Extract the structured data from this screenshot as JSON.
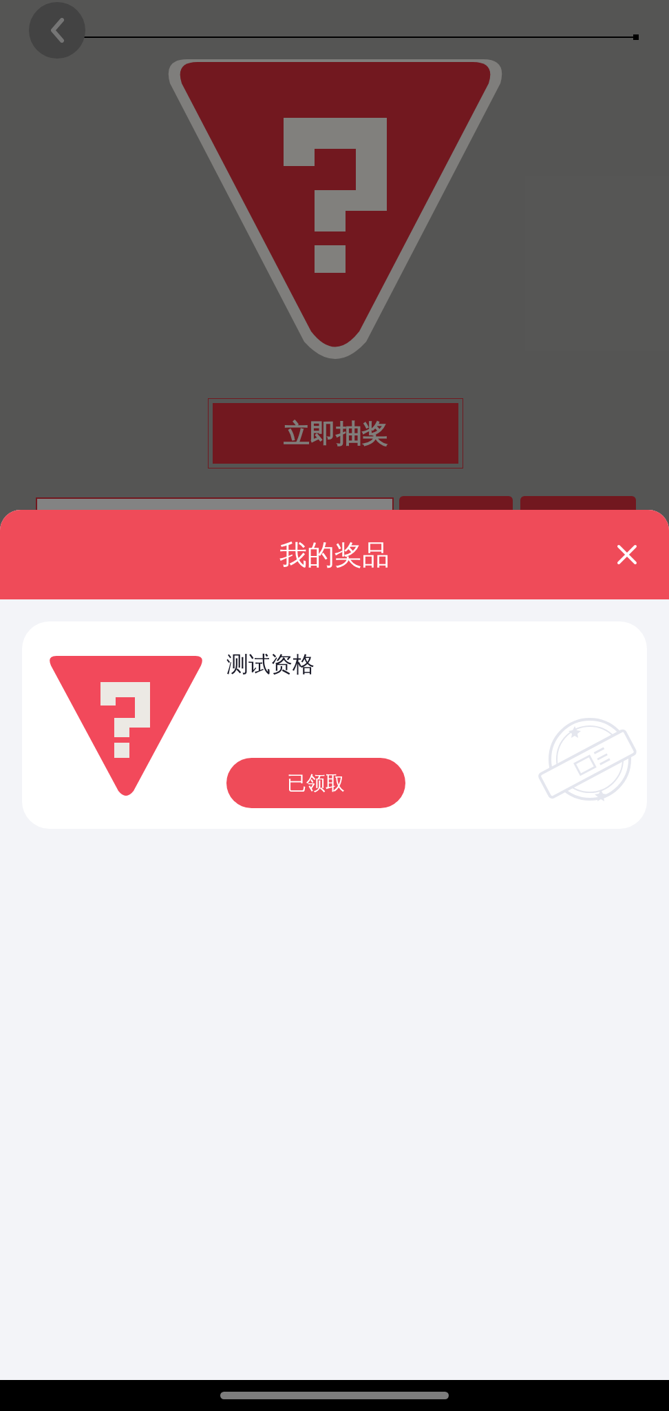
{
  "back_page": {
    "draw_button": "立即抽奖"
  },
  "prize_sheet": {
    "title": "我的奖品",
    "prizes": [
      {
        "name": "测试资格",
        "button": "已领取",
        "claimed": true
      }
    ]
  }
}
